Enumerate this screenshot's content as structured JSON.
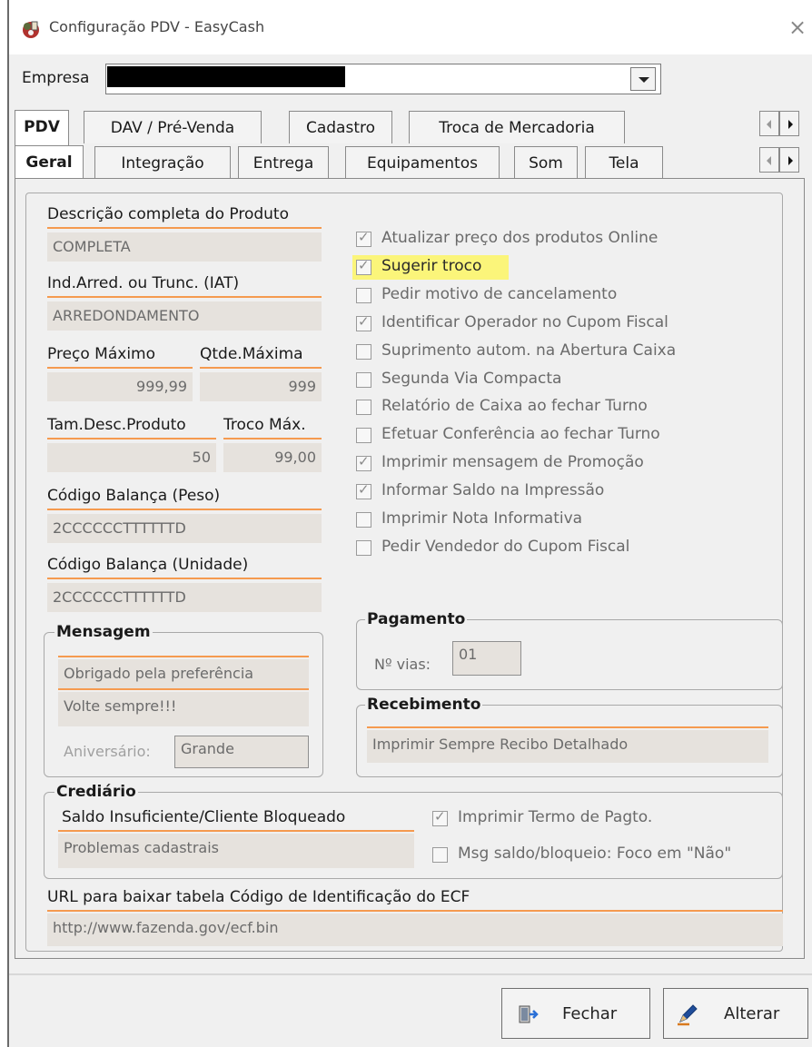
{
  "window": {
    "title": "Configuração PDV - EasyCash",
    "close_glyph": "×"
  },
  "empresa": {
    "label": "Empresa",
    "value": ""
  },
  "tabs_top": [
    {
      "label": "PDV",
      "active": true
    },
    {
      "label": "DAV / Pré-Venda"
    },
    {
      "label": "Cadastro"
    },
    {
      "label": "Troca de Mercadoria"
    }
  ],
  "tabs_sub": [
    {
      "label": "Geral",
      "active": true
    },
    {
      "label": "Integração"
    },
    {
      "label": "Entrega"
    },
    {
      "label": "Equipamentos"
    },
    {
      "label": "Som"
    },
    {
      "label": "Tela"
    }
  ],
  "fields": {
    "descricao": {
      "label": "Descrição completa do Produto",
      "value": "COMPLETA"
    },
    "iat": {
      "label": "Ind.Arred. ou Trunc. (IAT)",
      "value": "ARREDONDAMENTO"
    },
    "preco_max": {
      "label": "Preço Máximo",
      "value": "999,99"
    },
    "qtde_max": {
      "label": "Qtde.Máxima",
      "value": "999"
    },
    "tam_desc": {
      "label": "Tam.Desc.Produto",
      "value": "50"
    },
    "troco_max": {
      "label": "Troco Máx.",
      "value": "99,00"
    },
    "cod_peso": {
      "label": "Código Balança (Peso)",
      "value": "2CCCCCCTTTTTTD"
    },
    "cod_unid": {
      "label": "Código Balança (Unidade)",
      "value": "2CCCCCCTTTTTTD"
    }
  },
  "options": [
    {
      "label": "Atualizar preço dos produtos Online",
      "checked": true
    },
    {
      "label": "Sugerir troco",
      "checked": true,
      "highlighted": true
    },
    {
      "label": "Pedir motivo de cancelamento",
      "checked": false
    },
    {
      "label": "Identificar Operador no Cupom Fiscal",
      "checked": true
    },
    {
      "label": "Suprimento autom. na Abertura Caixa",
      "checked": false
    },
    {
      "label": "Segunda Via Compacta",
      "checked": false
    },
    {
      "label": "Relatório de Caixa ao fechar Turno",
      "checked": false
    },
    {
      "label": "Efetuar Conferência ao fechar Turno",
      "checked": false
    },
    {
      "label": "Imprimir mensagem de Promoção",
      "checked": true
    },
    {
      "label": "Informar Saldo na Impressão",
      "checked": true
    },
    {
      "label": "Imprimir Nota Informativa",
      "checked": false
    },
    {
      "label": "Pedir Vendedor do Cupom Fiscal",
      "checked": false
    }
  ],
  "mensagem": {
    "title": "Mensagem",
    "line1": "Obrigado pela preferência",
    "line2": "Volte sempre!!!",
    "aniversario_label": "Aniversário:",
    "aniversario_value": "Grande"
  },
  "pagamento": {
    "title": "Pagamento",
    "vias_label": "Nº vias:",
    "vias_value": "01"
  },
  "recebimento": {
    "title": "Recebimento",
    "value": "Imprimir Sempre Recibo Detalhado"
  },
  "crediario": {
    "title": "Crediário",
    "saldo_label": "Saldo Insuficiente/Cliente Bloqueado",
    "saldo_value": "Problemas cadastrais",
    "termo_label": "Imprimir Termo de Pagto.",
    "termo_checked": true,
    "foco_label": "Msg saldo/bloqueio: Foco em \"Não\"",
    "foco_checked": false
  },
  "url": {
    "label": "URL para baixar tabela Código de Identificação do ECF",
    "value": "http://www.fazenda.gov/ecf.bin"
  },
  "buttons": {
    "fechar": "Fechar",
    "alterar": "Alterar"
  },
  "colors": {
    "accent_underline": "#f59a4f",
    "highlight": "#fbf57a",
    "field_bg": "#e6e2dd"
  }
}
